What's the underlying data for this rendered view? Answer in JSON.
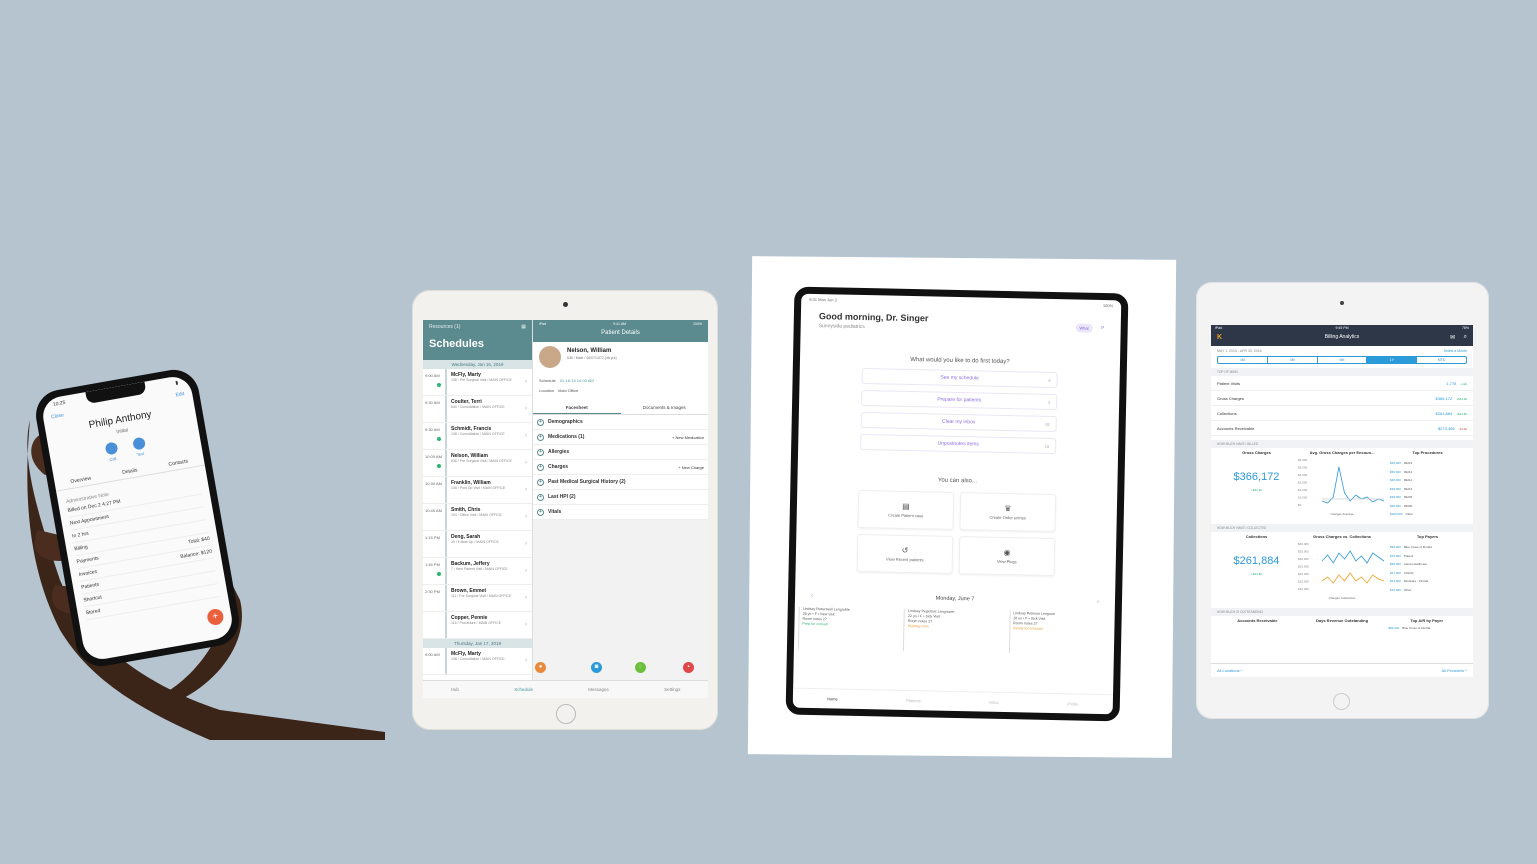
{
  "phone": {
    "time": "10:25",
    "nav_left": "Close",
    "nav_right": "Edit",
    "name": "Philip Anthony",
    "sub": "Initial",
    "actions": [
      "Call",
      "Text"
    ],
    "tabs": [
      "Overview",
      "Details",
      "Contacts"
    ],
    "section": "Administrative Note",
    "items": [
      {
        "label": "Billed on Dec 2 4:27 PM",
        "value": ""
      },
      {
        "label": "Next Appointment",
        "value": ""
      },
      {
        "label": "In 2 hrs",
        "value": ""
      },
      {
        "label": "Billing",
        "value": ""
      },
      {
        "label": "Payments",
        "value": "Total: $40"
      },
      {
        "label": "Invoices",
        "value": "Balance: $120"
      },
      {
        "label": "Patients",
        "value": ""
      },
      {
        "label": "Shortcut",
        "value": ""
      },
      {
        "label": "Stored",
        "value": ""
      }
    ]
  },
  "ipad1": {
    "status_left": "iPad",
    "status_time": "9:41 AM",
    "status_right": "100%",
    "resources": "Resources (1)",
    "title": "Schedules",
    "date1": "Wednesday, Jan 16, 2019",
    "date2": "Thursday, Jan 17, 2019",
    "appointments": [
      {
        "time": "9:00 AM",
        "name": "McFly, Marty",
        "detail": "108 / Pre Surgical Visit / MAIN OFFICE",
        "dot": true
      },
      {
        "time": "9:30 AM",
        "name": "Coulter, Terri",
        "detail": "640 / Consultation / MAIN OFFICE",
        "dot": false
      },
      {
        "time": "9:30 AM",
        "name": "Schmidt, Francis",
        "detail": "108 / Consultation / MAIN OFFICE",
        "dot": true
      },
      {
        "time": "10:00 AM",
        "name": "Nelson, William",
        "detail": "636 / Pre Surgical Visit / MAIN OFFICE",
        "dot": true
      },
      {
        "time": "10:30 AM",
        "name": "Franklin, William",
        "detail": "108 / Post Op Visit / MAIN OFFICE",
        "dot": false
      },
      {
        "time": "10:45 AM",
        "name": "Smith, Chris",
        "detail": "104 / Office Visit / MAIN OFFICE",
        "dot": false
      },
      {
        "time": "1:15 PM",
        "name": "Deng, Sarah",
        "detail": "39 / Follow Up / MAIN OFFICE",
        "dot": false
      },
      {
        "time": "1:45 PM",
        "name": "Backum, Jeffery",
        "detail": "7 / New Patient Visit / MAIN OFFICE",
        "dot": true
      },
      {
        "time": "2:30 PM",
        "name": "Brown, Emmet",
        "detail": "111 / Pre Surgical Visit / MAIN OFFICE",
        "dot": false
      },
      {
        "time": "",
        "name": "Copper, Pennie",
        "detail": "116 / Procedure / MAIN OFFICE",
        "dot": false
      }
    ],
    "next_appt": {
      "time": "9:00 AM",
      "name": "McFly, Marty",
      "detail": "108 / Consultation / MAIN OFFICE"
    },
    "panel_title": "Patient Details",
    "patient_name": "Nelson, William",
    "patient_detail": "636 / Male / 06/07/1972 (46 yrs)",
    "schedule_label": "Schedule",
    "schedule_value": "01-16-19 10:00 AM",
    "location_label": "Location",
    "location_value": "Main Office",
    "segments": [
      "Facesheet",
      "Documents & Images"
    ],
    "sections": [
      {
        "label": "Demographics",
        "action": ""
      },
      {
        "label": "Medications (1)",
        "action": "+ New Medication"
      },
      {
        "label": "Allergies",
        "action": ""
      },
      {
        "label": "Charges",
        "action": "+ New Charge"
      },
      {
        "label": "Past Medical Surgical History (2)",
        "action": ""
      },
      {
        "label": "Last HPI (2)",
        "action": ""
      },
      {
        "label": "Vitals",
        "action": ""
      }
    ],
    "tabs": [
      "Hub",
      "Schedule",
      "Messages",
      "Settings"
    ],
    "colors": {
      "header": "#5b8a8f",
      "accent": "#4a9aa0"
    }
  },
  "ipad2": {
    "status_left": "9:41 Mon Jun 3",
    "status_right": "100%",
    "greeting": "Good morning, Dr. Singer",
    "location": "Sunnyside pediatrics",
    "badge": "What",
    "question": "What would you like to do first today?",
    "options": [
      {
        "label": "See my schedule",
        "count": "6"
      },
      {
        "label": "Prepare for patients",
        "count": "4"
      },
      {
        "label": "Clear my inbox",
        "count": "28"
      },
      {
        "label": "Unpostnotes items",
        "count": "16"
      }
    ],
    "also_title": "You can also...",
    "tiles": [
      {
        "icon": "▤",
        "label": "Create Patient case"
      },
      {
        "icon": "♛",
        "label": "Create Order entries"
      },
      {
        "icon": "↺",
        "label": "View Recent patients"
      },
      {
        "icon": "◉",
        "label": "View Plugs"
      }
    ],
    "day": "Monday, June 7",
    "appts": [
      {
        "line1": "Lindsay Pettenwell Lengruble",
        "line2": "28 yo • F • New visit",
        "line3": "Room notes 27",
        "tag": "Prep for consult"
      },
      {
        "line1": "Lindsay Pegertive Lengruwer",
        "line2": "22 yo • F • Sick Visit",
        "line3": "Room notes 27",
        "tag": "Waiting room"
      },
      {
        "line1": "Lindsay Petrison Lengrum",
        "line2": "28 yo • F • Sick Visit",
        "line3": "Room notes 27",
        "tag": "Ready for prenatal"
      }
    ],
    "tabs": [
      "Home",
      "Patients",
      "Inbox",
      "Profile"
    ]
  },
  "ipad3": {
    "status_left": "iPad",
    "status_time": "9:45 PM",
    "status_right": "78%",
    "title": "Billing Analytics",
    "date_range": "MAY 1, 2015 - APR 30, 2016",
    "date_link": "Select a Month",
    "periods": [
      "1M",
      "3M",
      "6M",
      "1Y",
      "MTD"
    ],
    "active_period": "1Y",
    "top_section": "TOP OF MIND",
    "metrics": [
      {
        "label": "Patient Visits",
        "value": "1,778",
        "delta": "+12k",
        "dir": "up"
      },
      {
        "label": "Gross Charges",
        "value": "$366,172",
        "delta": "+$34.9k",
        "dir": "up"
      },
      {
        "label": "Collections",
        "value": "$261,884",
        "delta": "+$24.8k",
        "dir": "up"
      },
      {
        "label": "Accounts Receivable",
        "value": "$273,366",
        "delta": "-$1.9k",
        "dir": "down"
      }
    ],
    "billed_section": "HOW MUCH HAVE I BILLED",
    "billed_cols": [
      "Gross Charges",
      "Avg. Gross Charges per Encoun...",
      "Top Procedures"
    ],
    "billed_big": "$366,172",
    "billed_big_sub": "+$34.9k",
    "billed_axis": [
      "$6,000",
      "$5,000",
      "$4,000",
      "$3,000",
      "$2,000",
      "$1,000",
      "$0"
    ],
    "billed_legend": "Charges  Average",
    "procedures": [
      {
        "value": "$50,000",
        "label": "99213"
      },
      {
        "value": "$50,000",
        "label": "99214"
      },
      {
        "value": "$48,000",
        "label": "99214"
      },
      {
        "value": "$48,000",
        "label": "99213"
      },
      {
        "value": "$48,000",
        "label": "99203"
      },
      {
        "value": "$48,000",
        "label": "99030"
      },
      {
        "value": "$105,000",
        "label": "Other"
      }
    ],
    "collected_section": "HOW MUCH HAVE I COLLECTED",
    "collected_cols": [
      "Collections",
      "Gross Charges vs. Collections",
      "Top Payers"
    ],
    "collected_big": "$261,884",
    "collected_big_sub": "+$24.8k",
    "collected_axis": [
      "$40,000",
      "$35,000",
      "$30,000",
      "$25,000",
      "$20,000",
      "$15,000",
      "$10,000"
    ],
    "collected_legend": "Charges  Collections",
    "payers": [
      {
        "value": "$99,000",
        "label": "Blue Cross of Florida"
      },
      {
        "value": "$76,000",
        "label": "Patient"
      },
      {
        "value": "$58,000",
        "label": "Aetna Healthcare"
      },
      {
        "value": "$27,000",
        "label": "CIGNA"
      },
      {
        "value": "$23,000",
        "label": "Medicare - Florida"
      },
      {
        "value": "$16,000",
        "label": "Other"
      }
    ],
    "outstanding_section": "HOW MUCH IS OUTSTANDING",
    "outstanding_cols": [
      "Accounts Receivable",
      "Days Revenue Outstanding",
      "Top A/R by Payer"
    ],
    "outstanding_payer": {
      "value": "$99,000",
      "label": "Blue Cross of Florida"
    },
    "footer_left": "All Locations ^",
    "footer_right": "All Providers ^",
    "colors": {
      "header": "#2d3748",
      "accent": "#2b9ad8",
      "up": "#2bb673",
      "down": "#e05050",
      "logo": "#f0a020"
    }
  }
}
